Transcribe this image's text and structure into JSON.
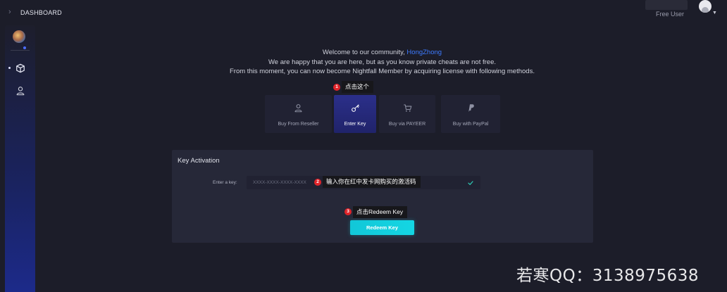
{
  "header": {
    "breadcrumb": "DASHBOARD",
    "user_role": "Free User"
  },
  "sidebar": {
    "items": [
      {
        "icon": "cube-icon",
        "active": true
      },
      {
        "icon": "user-icon",
        "active": false
      }
    ]
  },
  "welcome": {
    "line1_prefix": "Welcome to our community,",
    "line1_name": "HongZhong",
    "line2": "We are happy that you are here, but as you know private cheats are not free.",
    "line3": "From this moment, you can now become Nightfall Member by acquiring license with following methods."
  },
  "methods": [
    {
      "label": "Buy From Reseller",
      "icon": "user-icon"
    },
    {
      "label": "Enter Key",
      "icon": "key-icon",
      "active": true
    },
    {
      "label": "Buy via PAYEER",
      "icon": "cart-icon"
    },
    {
      "label": "Buy with PayPal",
      "icon": "paypal-icon"
    }
  ],
  "annotations": [
    {
      "num": "1",
      "text": "点击这个"
    },
    {
      "num": "2",
      "text": "输入你在红中发卡网购买的激活码"
    },
    {
      "num": "3",
      "text": "点击Redeem Key"
    }
  ],
  "activation": {
    "title": "Key Activation",
    "key_label": "Enter a key:",
    "key_placeholder": "XXXX-XXXX-XXXX-XXXX",
    "redeem_label": "Redeem Key"
  },
  "watermark": "若寒QQ：3138975638",
  "colors": {
    "background": "#1c1d29",
    "accent_blue": "#3d7bff",
    "redeem_button": "#14d6e3",
    "annotation_badge": "#e0242a"
  }
}
